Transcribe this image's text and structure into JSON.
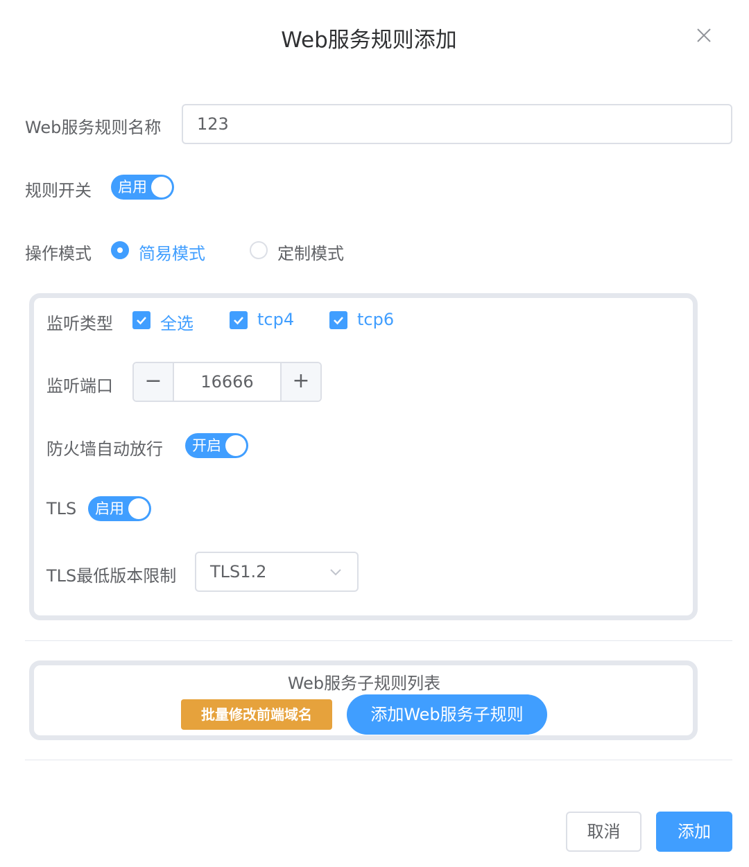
{
  "dialog": {
    "title": "Web服务规则添加",
    "close_icon": "close-icon"
  },
  "form": {
    "rule_name": {
      "label": "Web服务规则名称",
      "value": "123"
    },
    "rule_switch": {
      "label": "规则开关",
      "text": "启用",
      "on": true
    },
    "mode": {
      "label": "操作模式",
      "options": [
        {
          "label": "简易模式",
          "selected": true
        },
        {
          "label": "定制模式",
          "selected": false
        }
      ]
    }
  },
  "listen_panel": {
    "listen_type": {
      "label": "监听类型",
      "options": [
        {
          "label": "全选",
          "checked": true
        },
        {
          "label": "tcp4",
          "checked": true
        },
        {
          "label": "tcp6",
          "checked": true
        }
      ]
    },
    "listen_port": {
      "label": "监听端口",
      "value": "16666",
      "minus": "−",
      "plus": "+"
    },
    "firewall": {
      "label": "防火墙自动放行",
      "text": "开启",
      "on": true
    },
    "tls": {
      "label": "TLS",
      "text": "启用",
      "on": true
    },
    "tls_min": {
      "label": "TLS最低版本限制",
      "value": "TLS1.2"
    }
  },
  "sub_rules": {
    "title": "Web服务子规则列表",
    "batch_button": "批量修改前端域名",
    "add_button": "添加Web服务子规则"
  },
  "footer": {
    "cancel": "取消",
    "submit": "添加"
  },
  "colors": {
    "primary": "#409eff",
    "warning": "#e6a23c",
    "border": "#dcdfe6"
  }
}
